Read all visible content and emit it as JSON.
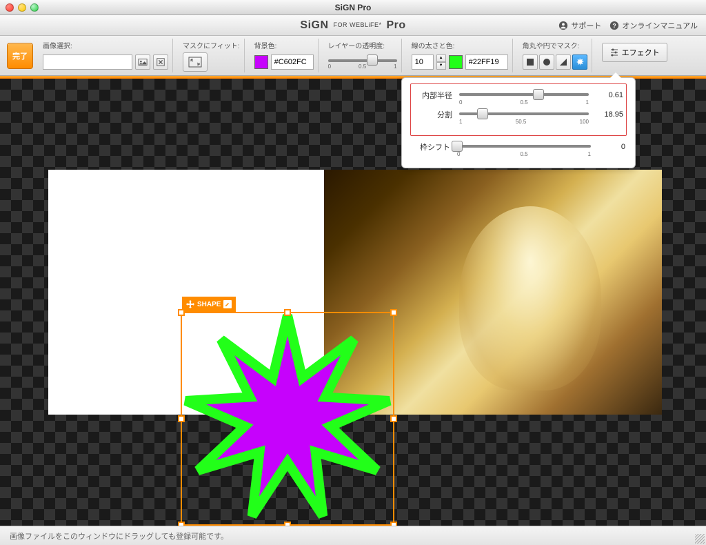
{
  "window": {
    "title": "SiGN Pro"
  },
  "header": {
    "logo_main": "SiGN",
    "logo_sub": "FOR WEBLiFE*",
    "logo_suffix": "Pro",
    "support": "サポート",
    "manual": "オンラインマニュアル"
  },
  "toolbar": {
    "done": "完了",
    "image_select": {
      "label": "画像選択:"
    },
    "mask_fit": {
      "label": "マスクにフィット:"
    },
    "bg_color": {
      "label": "背景色:",
      "hex": "#C602FC"
    },
    "opacity": {
      "label": "レイヤーの透明度:",
      "min": "0",
      "mid": "0.5",
      "max": "1"
    },
    "stroke": {
      "label": "線の太さと色:",
      "width": "10",
      "hex": "#22FF19"
    },
    "mask_shape": {
      "label": "角丸や円でマスク:"
    },
    "effect": "エフェクト"
  },
  "popover": {
    "rows": [
      {
        "label": "内部半径",
        "min": "0",
        "mid": "0.5",
        "max": "1",
        "value": "0.61",
        "pos": 61
      },
      {
        "label": "分割",
        "min": "1",
        "mid": "50.5",
        "max": "100",
        "value": "18.95",
        "pos": 18
      },
      {
        "label": "枠シフト",
        "min": "0",
        "mid": "0.5",
        "max": "1",
        "value": "0",
        "pos": 0
      }
    ]
  },
  "shape": {
    "tag": "SHAPE",
    "fill": "#C602FC",
    "stroke": "#22FF19"
  },
  "status": {
    "text": "画像ファイルをこのウィンドウにドラッグしても登録可能です。"
  }
}
